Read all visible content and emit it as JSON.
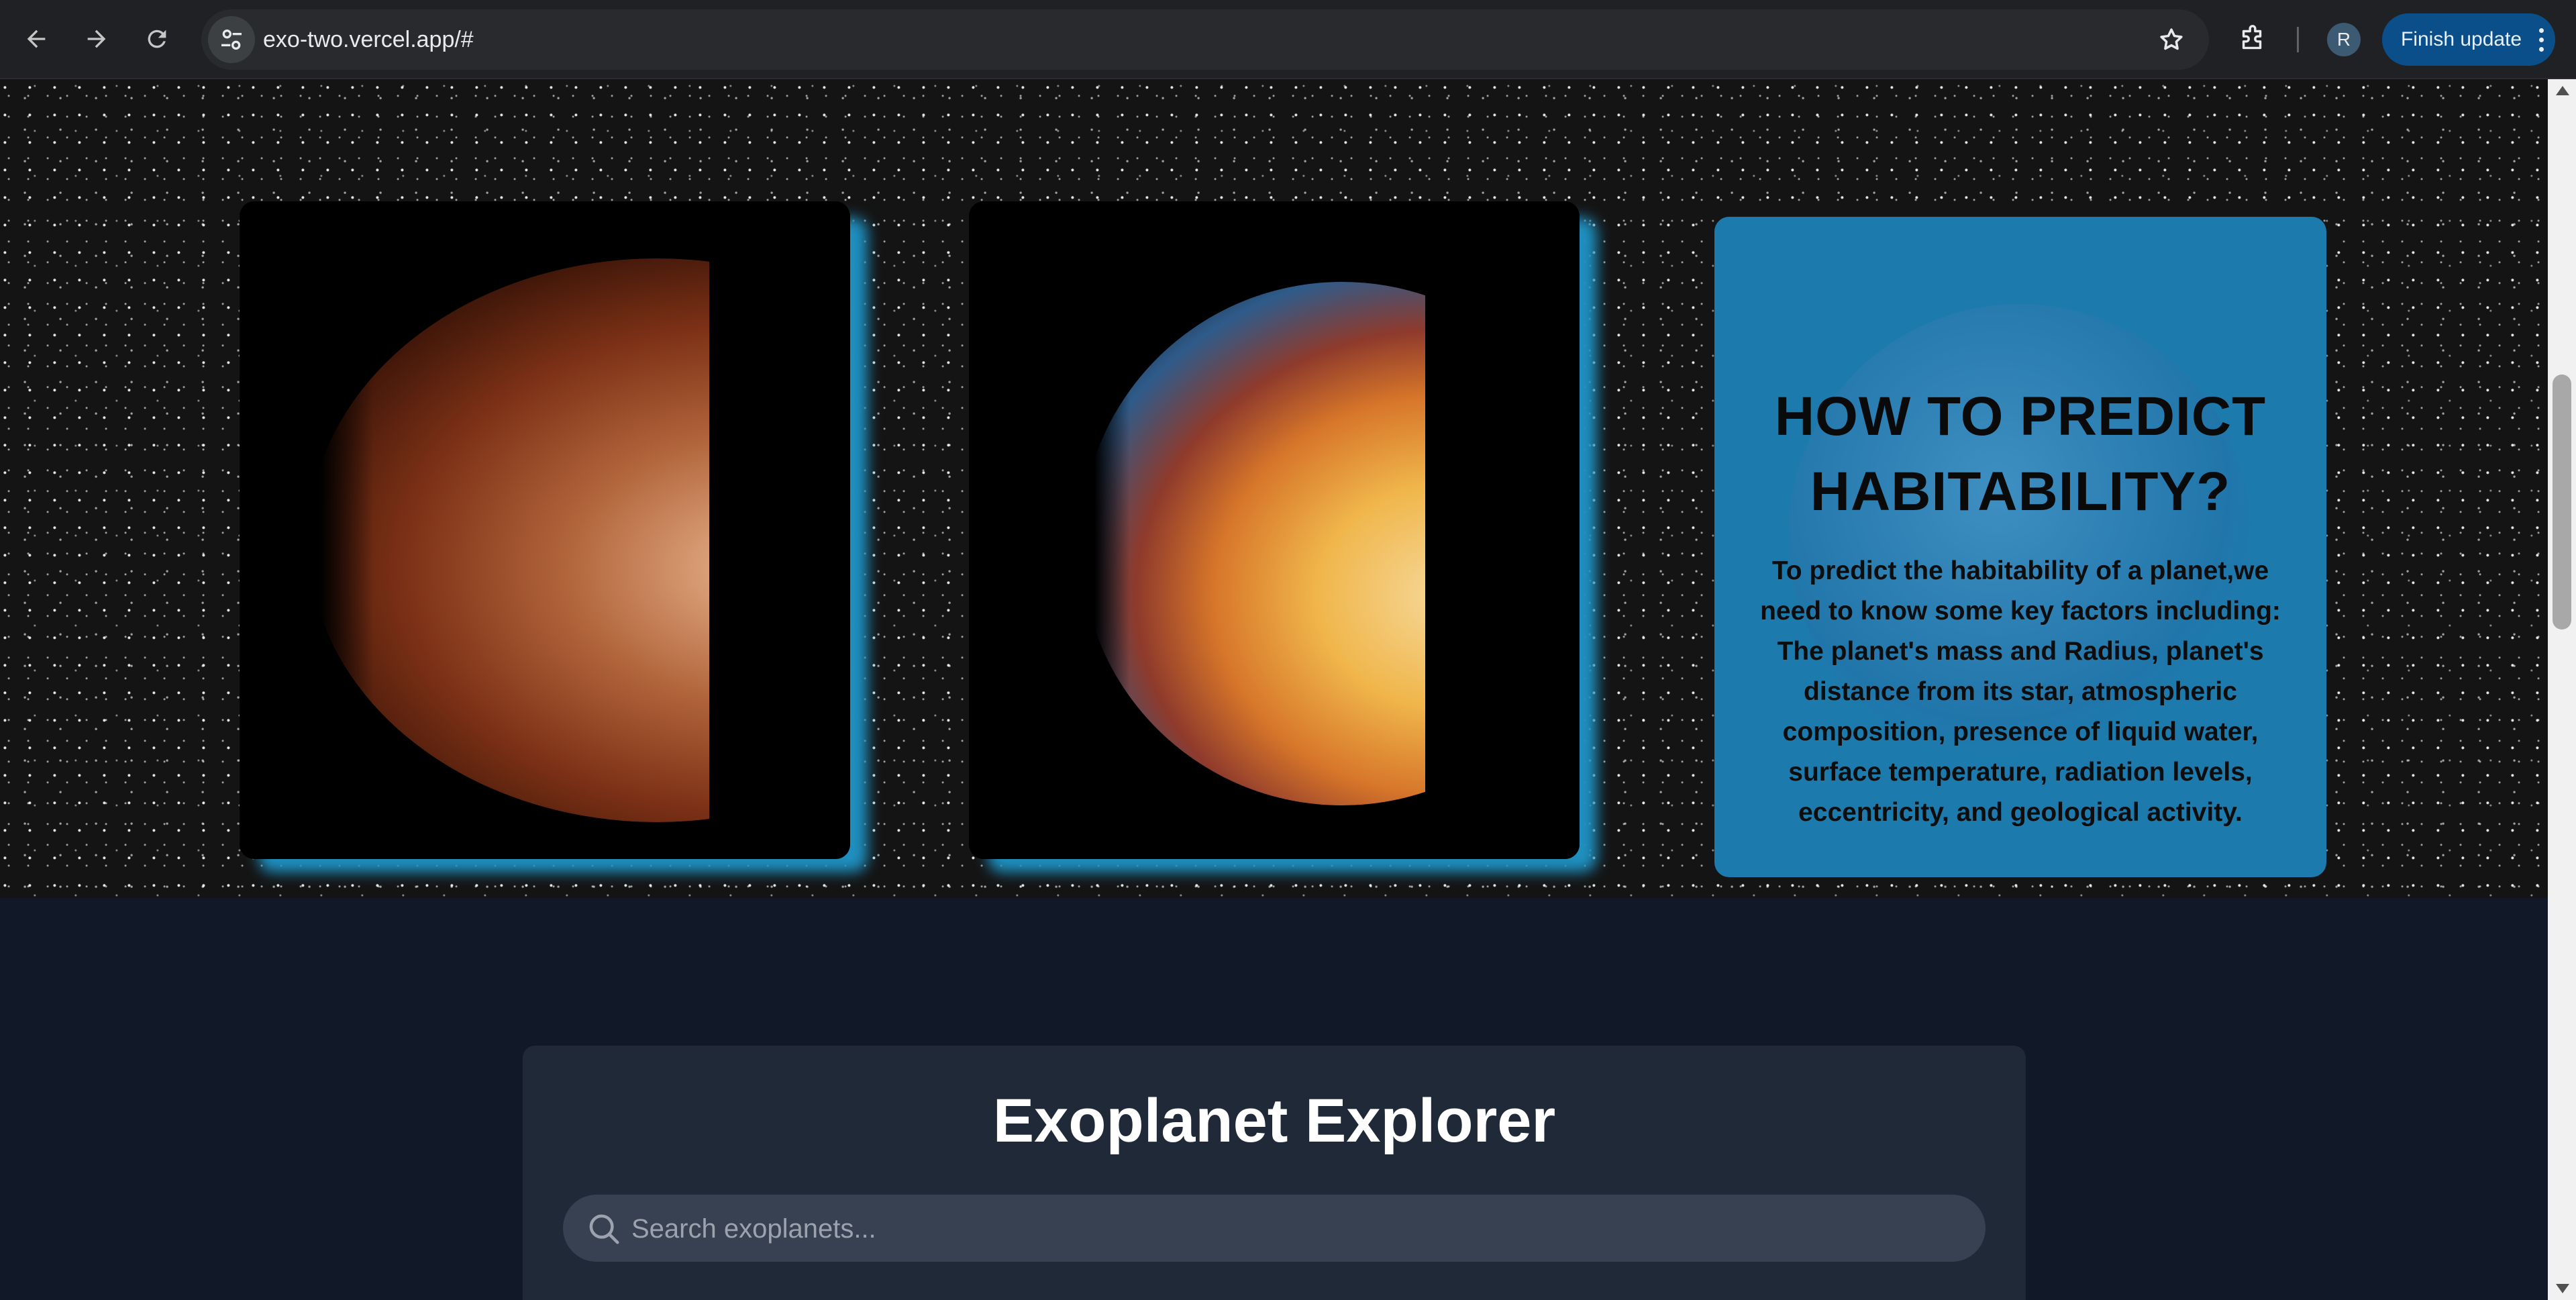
{
  "browser": {
    "url": "exo-two.vercel.app/#",
    "avatar_letter": "R",
    "finish_update_label": "Finish update"
  },
  "hero": {
    "info_title": "HOW TO PREDICT\nHABITABILITY?",
    "info_body": "To predict the habitability of a planet,we need to know some key factors including: The planet's mass and Radius, planet's distance from its star, atmospheric composition, presence of liquid water, surface temperature, radiation levels, eccentricity, and geological activity."
  },
  "explorer": {
    "title": "Exoplanet Explorer",
    "search_placeholder": "Search exoplanets..."
  },
  "colors": {
    "accent_blue": "#1d7aad",
    "page_bg": "#111827",
    "panel_bg": "#1f2937",
    "search_bg": "#374151",
    "update_button": "#0b4f8a"
  }
}
